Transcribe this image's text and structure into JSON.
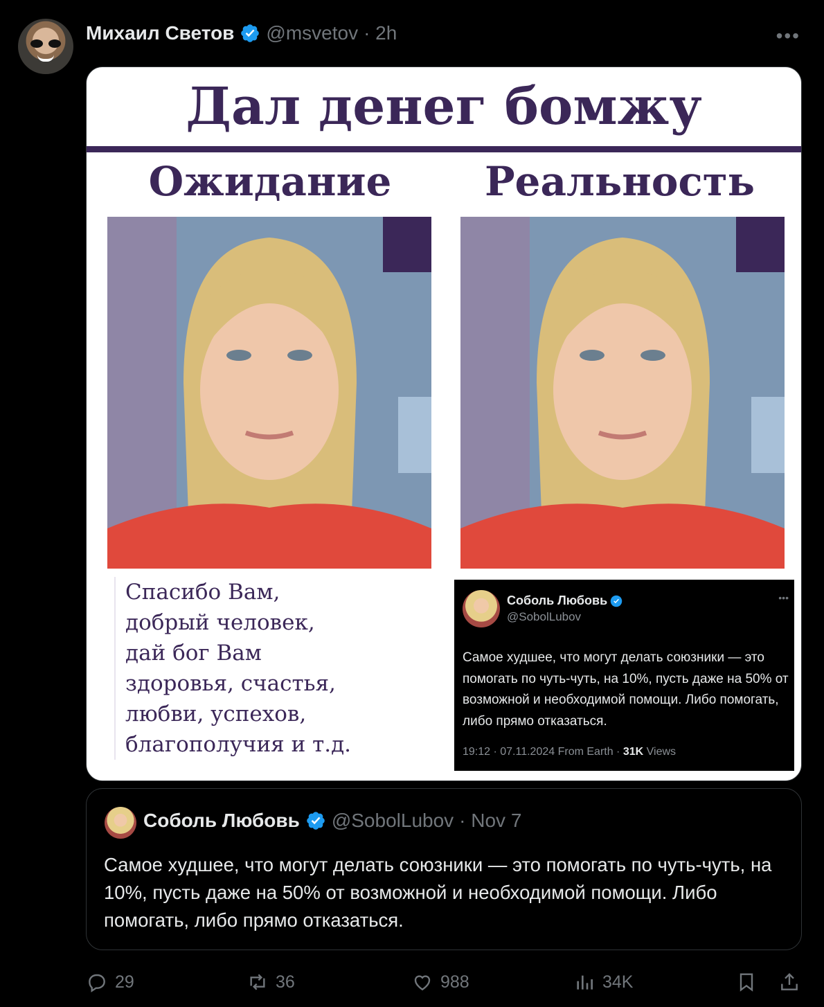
{
  "tweet": {
    "author_name": "Михаил Светов",
    "author_handle": "@msvetov",
    "time": "· 2h",
    "more_label": "•••"
  },
  "meme": {
    "title": "Дал денег бомжу",
    "left_heading": "Ожидание",
    "right_heading": "Реальность",
    "left_text_lines": [
      "Спасибо Вам,",
      "добрый человек,",
      "дай бог Вам",
      "здоровья, счастья,",
      "любви, успехов,",
      "благополучия и т.д."
    ],
    "inner_tweet": {
      "name": "Соболь Любовь",
      "handle": "@SobolLubov",
      "more": "•••",
      "body": "Самое худшее, что могут делать союзники — это помогать по чуть-чуть, на 10%, пусть даже на 50% от возможной и необходимой помощи. Либо помогать, либо прямо отказаться.",
      "meta_prefix": "19:12 · 07.11.2024 From Earth · ",
      "views_count": "31K",
      "views_label": " Views"
    }
  },
  "quoted": {
    "name": "Соболь Любовь",
    "handle": "@SobolLubov",
    "time": "· Nov 7",
    "body": "Самое худшее, что могут делать союзники — это помогать по чуть-чуть, на 10%, пусть даже на 50% от возможной и необходимой помощи. Либо помогать, либо прямо отказаться."
  },
  "actions": {
    "replies": "29",
    "reposts": "36",
    "likes": "988",
    "views": "34K"
  },
  "colors": {
    "background": "#000000",
    "text": "#e7e9ea",
    "muted": "#71767b",
    "verified": "#1d9bf0",
    "meme_purple": "#3b2758",
    "border": "#2f3336"
  },
  "icons": [
    "verified-badge-icon",
    "more-icon",
    "reply-icon",
    "repost-icon",
    "like-icon",
    "views-icon",
    "bookmark-icon",
    "share-icon"
  ]
}
